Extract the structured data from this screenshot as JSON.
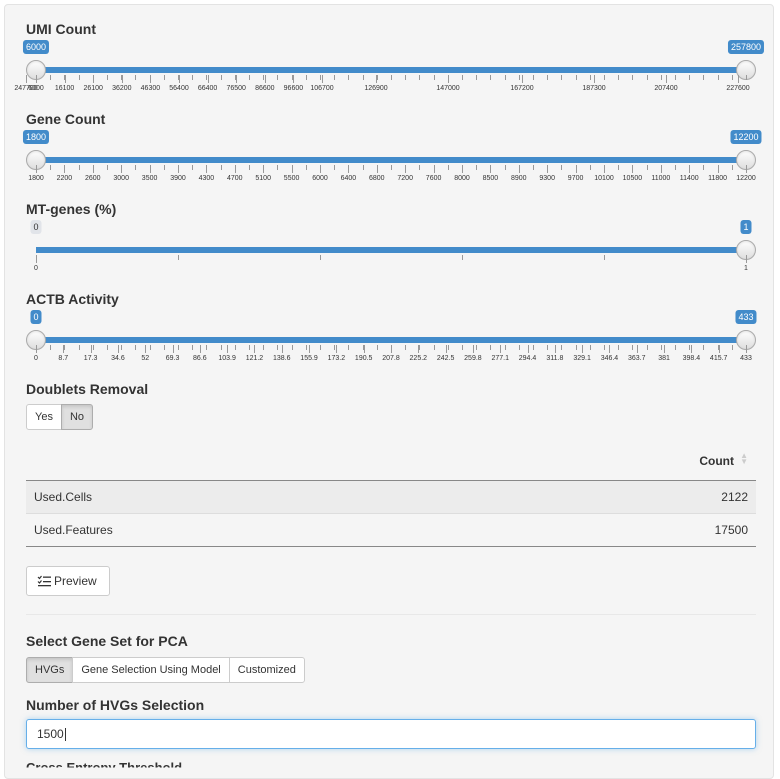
{
  "umi": {
    "label": "UMI Count",
    "min_value": "6000",
    "max_value": "257800",
    "ticks": [
      "6000",
      "16100",
      "26100",
      "36200",
      "46300",
      "56400",
      "66400",
      "76500",
      "86600",
      "96600",
      "106700",
      "126900",
      "147000",
      "167200",
      "187300",
      "207400",
      "227600",
      "247700"
    ]
  },
  "gene": {
    "label": "Gene Count",
    "min_value": "1800",
    "max_value": "12200",
    "ticks": [
      "1800",
      "2200",
      "2600",
      "3000",
      "3500",
      "3900",
      "4300",
      "4700",
      "5100",
      "5500",
      "6000",
      "6400",
      "6800",
      "7200",
      "7600",
      "8000",
      "8500",
      "8900",
      "9300",
      "9700",
      "10100",
      "10500",
      "11000",
      "11400",
      "11800",
      "12200"
    ]
  },
  "mt": {
    "label": "MT-genes (%)",
    "min_value": "0",
    "max_value": "1",
    "ticks": [
      "0",
      "1"
    ]
  },
  "actb": {
    "label": "ACTB Activity",
    "min_value": "0",
    "max_value": "433",
    "ticks": [
      "0",
      "8.7",
      "17.3",
      "34.6",
      "52",
      "69.3",
      "86.6",
      "103.9",
      "121.2",
      "138.6",
      "155.9",
      "173.2",
      "190.5",
      "207.8",
      "225.2",
      "242.5",
      "259.8",
      "277.1",
      "294.4",
      "311.8",
      "329.1",
      "346.4",
      "363.7",
      "381",
      "398.4",
      "415.7",
      "433"
    ]
  },
  "doublets": {
    "label": "Doublets Removal",
    "options": [
      "Yes",
      "No"
    ],
    "selected": "No"
  },
  "table": {
    "header": "Count",
    "rows": [
      {
        "name": "Used.Cells",
        "value": "2122"
      },
      {
        "name": "Used.Features",
        "value": "17500"
      }
    ]
  },
  "preview_label": "Preview",
  "geneset": {
    "label": "Select Gene Set for PCA",
    "options": [
      "HVGs",
      "Gene Selection Using Model",
      "Customized"
    ],
    "selected": "HVGs"
  },
  "hvgs": {
    "label": "Number of HVGs Selection",
    "value": "1500"
  },
  "cutoff_label": "Cross Entropy Threshold"
}
